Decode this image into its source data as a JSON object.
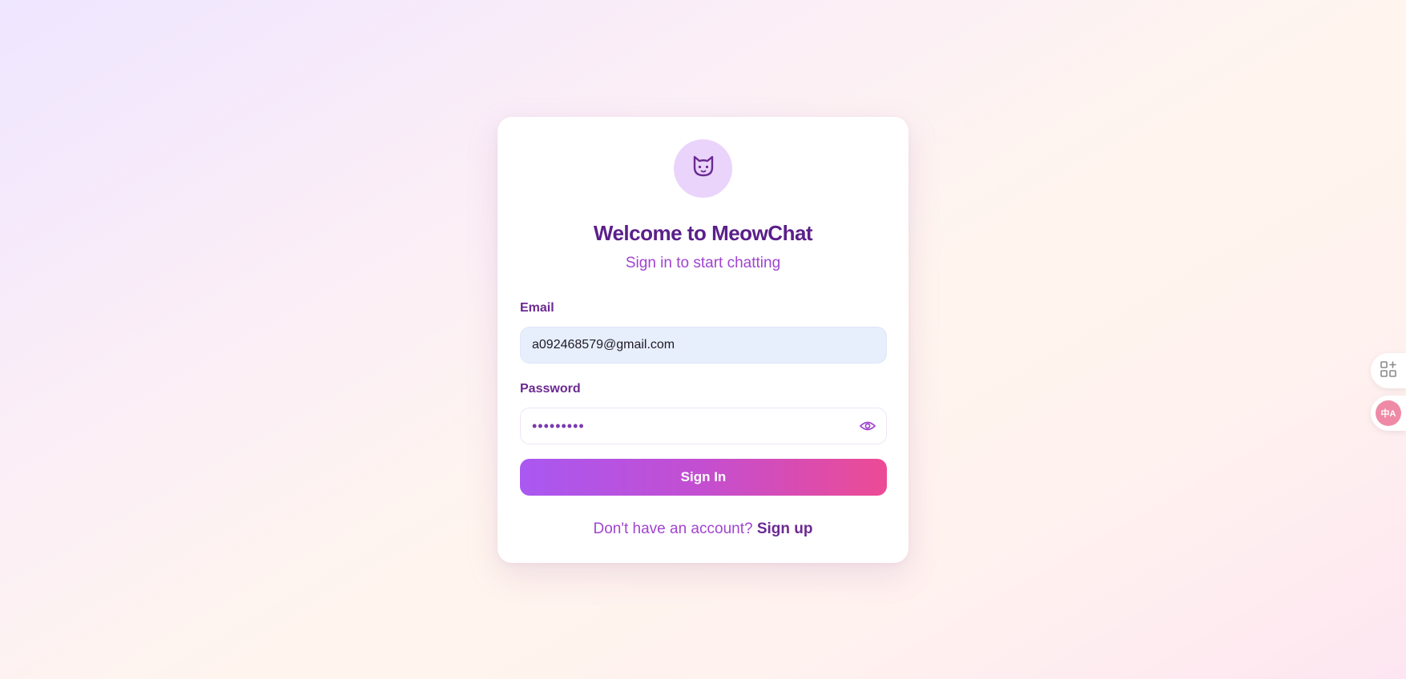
{
  "header": {
    "title": "Welcome to MeowChat",
    "subtitle": "Sign in to start chatting"
  },
  "logo": {
    "icon": "cat-icon"
  },
  "form": {
    "email_label": "Email",
    "email_value": "a092468579@gmail.com",
    "password_label": "Password",
    "password_mask": "•••••••••",
    "password_toggle_icon": "eye-icon",
    "submit_label": "Sign In"
  },
  "footer": {
    "prompt": "Don't have an account?",
    "signup_label": "Sign up"
  },
  "side_toolbar": {
    "apps_icon": "apps-add-icon",
    "translate_icon": "translate-icon",
    "translate_glyph": "中A"
  },
  "colors": {
    "accent": "#a044d0",
    "title": "#5b1f8a",
    "button_start": "#a958f1",
    "button_end": "#ec4b94"
  }
}
